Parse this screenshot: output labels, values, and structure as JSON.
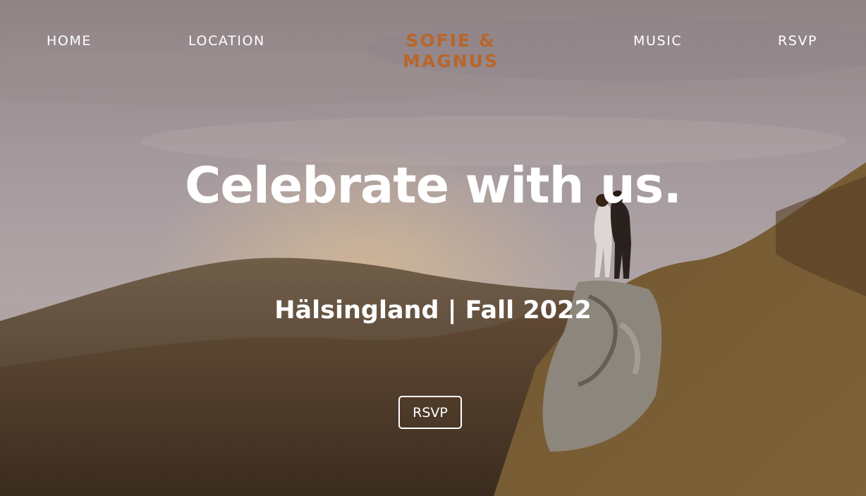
{
  "nav": {
    "items": [
      {
        "label": "HOME"
      },
      {
        "label": "LOCATION"
      },
      {
        "label": "MUSIC"
      },
      {
        "label": "RSVP"
      }
    ],
    "brand": "SOFIE & MAGNUS"
  },
  "hero": {
    "headline": "Celebrate with us.",
    "subline": "Hälsingland | Fall 2022",
    "button_label": "RSVP",
    "background_image": "couple-on-hillside-at-sunset"
  },
  "colors": {
    "brand": "#b8662a",
    "text": "#ffffff"
  }
}
